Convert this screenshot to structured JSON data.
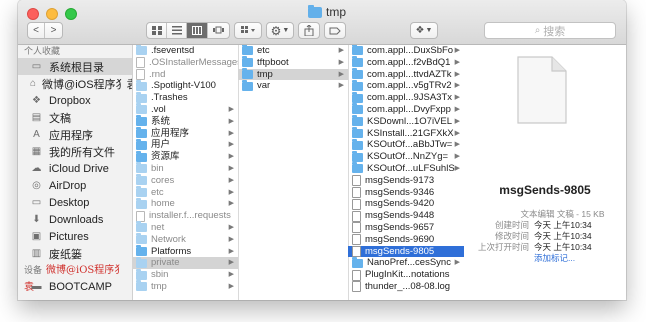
{
  "window": {
    "title": "tmp"
  },
  "toolbar": {
    "back": "<",
    "forward": ">",
    "search_placeholder": "搜索"
  },
  "sidebar": {
    "favorites_header": "个人收藏",
    "favorites": [
      {
        "label": "系统根目录",
        "icon": "hard-drive-icon",
        "selected": true
      },
      {
        "label": "微博@iOS程序犭袁",
        "icon": "home-icon"
      },
      {
        "label": "Dropbox",
        "icon": "dropbox-icon"
      },
      {
        "label": "文稿",
        "icon": "document-icon"
      },
      {
        "label": "应用程序",
        "icon": "applications-icon"
      },
      {
        "label": "我的所有文件",
        "icon": "all-files-icon"
      },
      {
        "label": "iCloud Drive",
        "icon": "cloud-icon"
      },
      {
        "label": "AirDrop",
        "icon": "airdrop-icon"
      },
      {
        "label": "Desktop",
        "icon": "desktop-icon"
      },
      {
        "label": "Downloads",
        "icon": "downloads-icon"
      },
      {
        "label": "Pictures",
        "icon": "pictures-icon"
      },
      {
        "label": "废纸篓",
        "icon": "trash-icon"
      }
    ],
    "devices_header": "设备",
    "devices_overlay": "微博@iOS程序犭袁",
    "devices": [
      {
        "label": "BOOTCAMP",
        "icon": "disk-icon"
      }
    ]
  },
  "columns": {
    "col1": [
      {
        "name": ".fseventsd",
        "kind": "folder",
        "dim": true
      },
      {
        "name": ".OSInstallerMessages",
        "kind": "file",
        "gray": true
      },
      {
        "name": ".rnd",
        "kind": "file",
        "gray": true
      },
      {
        "name": ".Spotlight-V100",
        "kind": "folder",
        "dim": true
      },
      {
        "name": ".Trashes",
        "kind": "folder",
        "dim": true
      },
      {
        "name": ".vol",
        "kind": "folder",
        "dim": true,
        "arrow": true
      },
      {
        "name": "系统",
        "kind": "folder",
        "arrow": true
      },
      {
        "name": "应用程序",
        "kind": "folder",
        "arrow": true
      },
      {
        "name": "用户",
        "kind": "folder",
        "arrow": true
      },
      {
        "name": "资源库",
        "kind": "folder",
        "arrow": true
      },
      {
        "name": "bin",
        "kind": "folder",
        "dim": true,
        "gray": true,
        "arrow": true
      },
      {
        "name": "cores",
        "kind": "folder",
        "dim": true,
        "gray": true,
        "arrow": true
      },
      {
        "name": "etc",
        "kind": "folder",
        "dim": true,
        "gray": true,
        "arrow": true
      },
      {
        "name": "home",
        "kind": "folder",
        "dim": true,
        "gray": true,
        "arrow": true
      },
      {
        "name": "installer.f...requests",
        "kind": "file",
        "gray": true
      },
      {
        "name": "net",
        "kind": "folder",
        "dim": true,
        "gray": true,
        "arrow": true
      },
      {
        "name": "Network",
        "kind": "folder",
        "dim": true,
        "gray": true,
        "arrow": true
      },
      {
        "name": "Platforms",
        "kind": "folder",
        "arrow": true
      },
      {
        "name": "private",
        "kind": "folder",
        "dim": true,
        "gray": true,
        "arrow": true,
        "highlight": true
      },
      {
        "name": "sbin",
        "kind": "folder",
        "dim": true,
        "gray": true,
        "arrow": true
      },
      {
        "name": "tmp",
        "kind": "folder",
        "dim": true,
        "gray": true,
        "arrow": true
      }
    ],
    "col2": [
      {
        "name": "etc",
        "kind": "folder",
        "arrow": true
      },
      {
        "name": "tftpboot",
        "kind": "folder",
        "arrow": true
      },
      {
        "name": "tmp",
        "kind": "folder",
        "arrow": true,
        "highlight": true
      },
      {
        "name": "var",
        "kind": "folder",
        "arrow": true
      }
    ],
    "col3": [
      {
        "name": "com.appl...DuxSbFo",
        "kind": "folder",
        "arrow": true
      },
      {
        "name": "com.appl...f2vBdQ1",
        "kind": "folder",
        "arrow": true
      },
      {
        "name": "com.appl...ttvdAZTk",
        "kind": "folder",
        "arrow": true
      },
      {
        "name": "com.appl...v5gTRv2",
        "kind": "folder",
        "arrow": true
      },
      {
        "name": "com.appl...9JSA3Tx",
        "kind": "folder",
        "arrow": true
      },
      {
        "name": "com.appl...DvyFxpp",
        "kind": "folder",
        "arrow": true
      },
      {
        "name": "KSDownl...1O7iVEL",
        "kind": "folder",
        "arrow": true
      },
      {
        "name": "KSInstall...21GFXkX",
        "kind": "folder",
        "arrow": true
      },
      {
        "name": "KSOutOf...aBbJTw=",
        "kind": "folder",
        "arrow": true
      },
      {
        "name": "KSOutOf...NnZYg=",
        "kind": "folder",
        "arrow": true
      },
      {
        "name": "KSOutOf...uLFSuhlS",
        "kind": "folder",
        "arrow": true
      },
      {
        "name": "msgSends-9173",
        "kind": "doc"
      },
      {
        "name": "msgSends-9346",
        "kind": "doc"
      },
      {
        "name": "msgSends-9420",
        "kind": "doc"
      },
      {
        "name": "msgSends-9448",
        "kind": "doc"
      },
      {
        "name": "msgSends-9657",
        "kind": "doc"
      },
      {
        "name": "msgSends-9690",
        "kind": "doc"
      },
      {
        "name": "msgSends-9805",
        "kind": "doc",
        "selected": true
      },
      {
        "name": "NanoPref...cesSync",
        "kind": "folder",
        "arrow": true
      },
      {
        "name": "PlugInKit...notations",
        "kind": "doc"
      },
      {
        "name": "thunder_...08-08.log",
        "kind": "doc"
      }
    ]
  },
  "preview": {
    "name": "msgSends-9805",
    "kind_label": "文本编辑 文稿 - 15 KB",
    "rows": [
      {
        "key": "创建时间",
        "value": "今天 上午10:34"
      },
      {
        "key": "修改时间",
        "value": "今天 上午10:34"
      },
      {
        "key": "上次打开时间",
        "value": "今天 上午10:34"
      }
    ],
    "add_tags": "添加标记..."
  },
  "colors": {
    "selection": "#2f6fd8",
    "folder": "#65b2ec",
    "highlight": "#d4d4d4"
  }
}
